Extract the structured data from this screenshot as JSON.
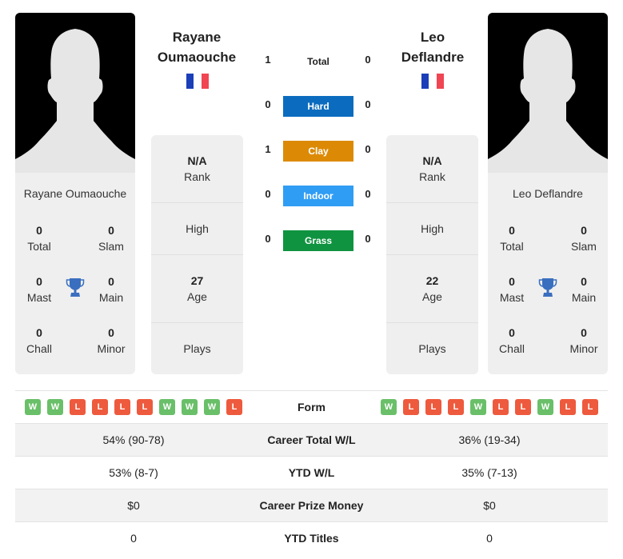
{
  "player1": {
    "name": "Rayane Oumaouche",
    "name_line1": "Rayane",
    "name_line2": "Oumaouche",
    "flag_colors": [
      "#1b3fb9",
      "#ffffff",
      "#f04552"
    ],
    "titles": {
      "total": {
        "value": "0",
        "label": "Total"
      },
      "slam": {
        "value": "0",
        "label": "Slam"
      },
      "mast": {
        "value": "0",
        "label": "Mast"
      },
      "main": {
        "value": "0",
        "label": "Main"
      },
      "chall": {
        "value": "0",
        "label": "Chall"
      },
      "minor": {
        "value": "0",
        "label": "Minor"
      }
    },
    "rank": {
      "value": "N/A",
      "label": "Rank"
    },
    "high": {
      "label": "High"
    },
    "age": {
      "value": "27",
      "label": "Age"
    },
    "plays": {
      "label": "Plays"
    },
    "form": [
      "W",
      "W",
      "L",
      "L",
      "L",
      "L",
      "W",
      "W",
      "W",
      "L"
    ],
    "career_total_wl": "54% (90-78)",
    "ytd_wl": "53% (8-7)",
    "career_prize_money": "$0",
    "ytd_titles": "0"
  },
  "player2": {
    "name": "Leo Deflandre",
    "name_line1": "Leo",
    "name_line2": "Deflandre",
    "flag_colors": [
      "#1b3fb9",
      "#ffffff",
      "#f04552"
    ],
    "titles": {
      "total": {
        "value": "0",
        "label": "Total"
      },
      "slam": {
        "value": "0",
        "label": "Slam"
      },
      "mast": {
        "value": "0",
        "label": "Mast"
      },
      "main": {
        "value": "0",
        "label": "Main"
      },
      "chall": {
        "value": "0",
        "label": "Chall"
      },
      "minor": {
        "value": "0",
        "label": "Minor"
      }
    },
    "rank": {
      "value": "N/A",
      "label": "Rank"
    },
    "high": {
      "label": "High"
    },
    "age": {
      "value": "22",
      "label": "Age"
    },
    "plays": {
      "label": "Plays"
    },
    "form": [
      "W",
      "L",
      "L",
      "L",
      "W",
      "L",
      "L",
      "W",
      "L",
      "L"
    ],
    "career_total_wl": "36% (19-34)",
    "ytd_wl": "35% (7-13)",
    "career_prize_money": "$0",
    "ytd_titles": "0"
  },
  "h2h": [
    {
      "label": "Total",
      "p1": "1",
      "p2": "0",
      "color": ""
    },
    {
      "label": "Hard",
      "p1": "0",
      "p2": "0",
      "color": "#0b6cbf"
    },
    {
      "label": "Clay",
      "p1": "1",
      "p2": "0",
      "color": "#dc8a06"
    },
    {
      "label": "Indoor",
      "p1": "0",
      "p2": "0",
      "color": "#2f9df4"
    },
    {
      "label": "Grass",
      "p1": "0",
      "p2": "0",
      "color": "#0f9340"
    }
  ],
  "comparison": {
    "form_label": "Form",
    "career_total_wl_label": "Career Total W/L",
    "ytd_wl_label": "YTD W/L",
    "career_prize_money_label": "Career Prize Money",
    "ytd_titles_label": "YTD Titles"
  },
  "icons": {
    "trophy": "trophy-icon",
    "avatar": "silhouette-avatar"
  },
  "colors": {
    "trophy": "#3a6fbf",
    "win": "#6abf69",
    "loss": "#ee5a3d",
    "card_bg": "#efefef"
  }
}
